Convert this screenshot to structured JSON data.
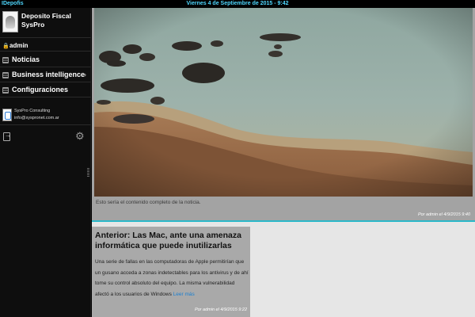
{
  "topbar": {
    "app_name": "IDepofis",
    "datetime": "Viernes 4 de Septiembre de 2015 - 9:42"
  },
  "sidebar": {
    "brand_title": "Deposito Fiscal",
    "brand_subtitle": "SysPro",
    "user_icon": "lock-icon",
    "user": "admin",
    "items": [
      {
        "label": "Noticias",
        "icon": "list-icon"
      },
      {
        "label": "Business intelligence",
        "icon": "list-icon",
        "has_submenu": true,
        "chevron": "›"
      },
      {
        "label": "Configuraciones",
        "icon": "list-icon"
      }
    ],
    "company_name": "SysPro Consulting",
    "company_email": "info@syspronet.com.ar",
    "logout_icon": "logout-icon",
    "settings_icon": "gear-icon"
  },
  "main": {
    "photo_post": {
      "caption": "Esto sería el contenido completo de la noticia.",
      "meta": "Por admin el 4/9/2015 9:40"
    },
    "news_post": {
      "title": "Anterior: Las Mac, ante una amenaza informática que puede inutilizarlas",
      "body": "Una serie de fallas en las computadoras de Apple permitirían que un gusano acceda a zonas indetectables para los antivirus y de ahí tome su control absoluto del equipo. La misma vulnerabilidad afectó a los usuarios de Windows",
      "read_more": "Leer más",
      "meta": "Por admin el 4/9/2015 9:22"
    }
  },
  "colors": {
    "accent": "#2bb8c9",
    "topbar_text": "#4fd8ff",
    "sidebar_bg": "#0e0e0e",
    "link": "#1a7fd0"
  }
}
